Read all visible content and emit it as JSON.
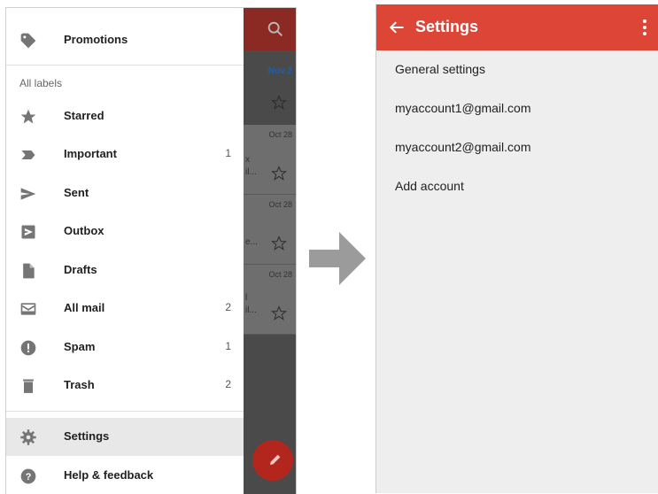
{
  "left_screen": {
    "drawer": {
      "top_item": {
        "label": "Promotions",
        "icon": "tag-icon"
      },
      "section_header": "All labels",
      "items": [
        {
          "label": "Starred",
          "icon": "star-icon",
          "count": ""
        },
        {
          "label": "Important",
          "icon": "important-icon",
          "count": "1"
        },
        {
          "label": "Sent",
          "icon": "send-icon",
          "count": ""
        },
        {
          "label": "Outbox",
          "icon": "outbox-icon",
          "count": ""
        },
        {
          "label": "Drafts",
          "icon": "draft-icon",
          "count": ""
        },
        {
          "label": "All mail",
          "icon": "all-mail-icon",
          "count": "2"
        },
        {
          "label": "Spam",
          "icon": "spam-icon",
          "count": "1"
        },
        {
          "label": "Trash",
          "icon": "trash-icon",
          "count": "2"
        }
      ],
      "footer_items": [
        {
          "label": "Settings",
          "icon": "gear-icon",
          "selected": true
        },
        {
          "label": "Help & feedback",
          "icon": "help-icon",
          "selected": false
        }
      ]
    },
    "background_inbox": {
      "date_header": "Nov 2",
      "message_dates": [
        "Oct 28",
        "Oct 28",
        "Oct 28"
      ],
      "fragments": [
        "x",
        "il...",
        "e...",
        "l",
        "il..."
      ]
    }
  },
  "right_screen": {
    "toolbar": {
      "title": "Settings",
      "back_icon": "arrow-left-icon",
      "menu_icon": "more-vert-icon"
    },
    "items": [
      "General settings",
      "myaccount1@gmail.com",
      "myaccount2@gmail.com",
      "Add account"
    ]
  },
  "colors": {
    "toolbar": "#dd4637",
    "drawer_bg": "#ffffff",
    "settings_bg": "#eeeeee",
    "arrow": "#9b9b9b"
  }
}
